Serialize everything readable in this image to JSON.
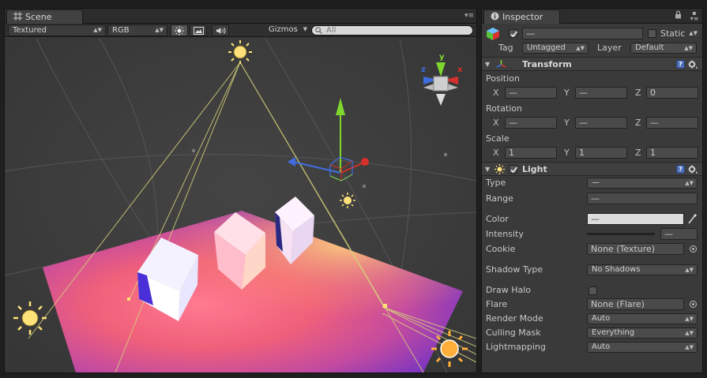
{
  "scene": {
    "tab_label": "Scene",
    "toolbar": {
      "render_mode": "Textured",
      "color_mode": "RGB",
      "gizmos_label": "Gizmos",
      "search_placeholder": "All"
    },
    "axis_gizmo": {
      "y_label": "y",
      "z_label": "z",
      "x_label": "x"
    }
  },
  "inspector": {
    "tab_label": "Inspector",
    "object": {
      "name": "—",
      "static_label": "Static",
      "tag_label": "Tag",
      "tag_value": "Untagged",
      "layer_label": "Layer",
      "layer_value": "Default"
    },
    "transform": {
      "title": "Transform",
      "position_label": "Position",
      "rotation_label": "Rotation",
      "scale_label": "Scale",
      "axis_x": "X",
      "axis_y": "Y",
      "axis_z": "Z",
      "position": {
        "x": "—",
        "y": "—",
        "z": "0"
      },
      "rotation": {
        "x": "—",
        "y": "—",
        "z": "—"
      },
      "scale": {
        "x": "1",
        "y": "1",
        "z": "1"
      }
    },
    "light": {
      "title": "Light",
      "type_label": "Type",
      "type_value": "—",
      "range_label": "Range",
      "range_value": "—",
      "color_label": "Color",
      "color_value": "—",
      "intensity_label": "Intensity",
      "intensity_value": "—",
      "cookie_label": "Cookie",
      "cookie_value": "None (Texture)",
      "shadow_type_label": "Shadow Type",
      "shadow_type_value": "No Shadows",
      "draw_halo_label": "Draw Halo",
      "flare_label": "Flare",
      "flare_value": "None (Flare)",
      "render_mode_label": "Render Mode",
      "render_mode_value": "Auto",
      "culling_mask_label": "Culling Mask",
      "culling_mask_value": "Everything",
      "lightmapping_label": "Lightmapping",
      "lightmapping_value": "Auto"
    },
    "help_glyph": "?"
  },
  "colors": {
    "axis_x": "#d8302a",
    "axis_y": "#7fd62e",
    "axis_z": "#3f6de0",
    "light_yellow": "#ffe17a",
    "light_orange": "#ffae3a"
  }
}
